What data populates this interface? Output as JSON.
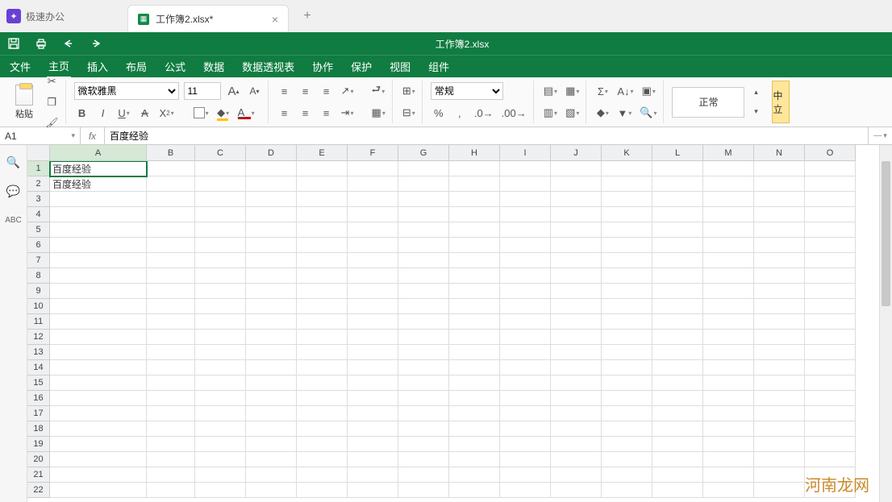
{
  "app": {
    "name": "极速办公"
  },
  "tab": {
    "title": "工作簿2.xlsx*"
  },
  "titlebar": {
    "filename": "工作簿2.xlsx"
  },
  "menu": {
    "items": [
      "文件",
      "主页",
      "插入",
      "布局",
      "公式",
      "数据",
      "数据透视表",
      "协作",
      "保护",
      "视图",
      "组件"
    ],
    "active_index": 1
  },
  "ribbon": {
    "paste_label": "粘贴",
    "font_name": "微软雅黑",
    "font_size": "11",
    "number_format": "常规",
    "style_label": "正常",
    "neutral_label": "中立"
  },
  "formula_bar": {
    "cell_ref": "A1",
    "formula": "百度经验"
  },
  "columns": [
    "A",
    "B",
    "C",
    "D",
    "E",
    "F",
    "G",
    "H",
    "I",
    "J",
    "K",
    "L",
    "M",
    "N",
    "O"
  ],
  "row_count": 22,
  "cells": {
    "A1": "百度经验",
    "A2": "百度经验"
  },
  "selected_cell": "A1",
  "watermark": "河南龙网"
}
